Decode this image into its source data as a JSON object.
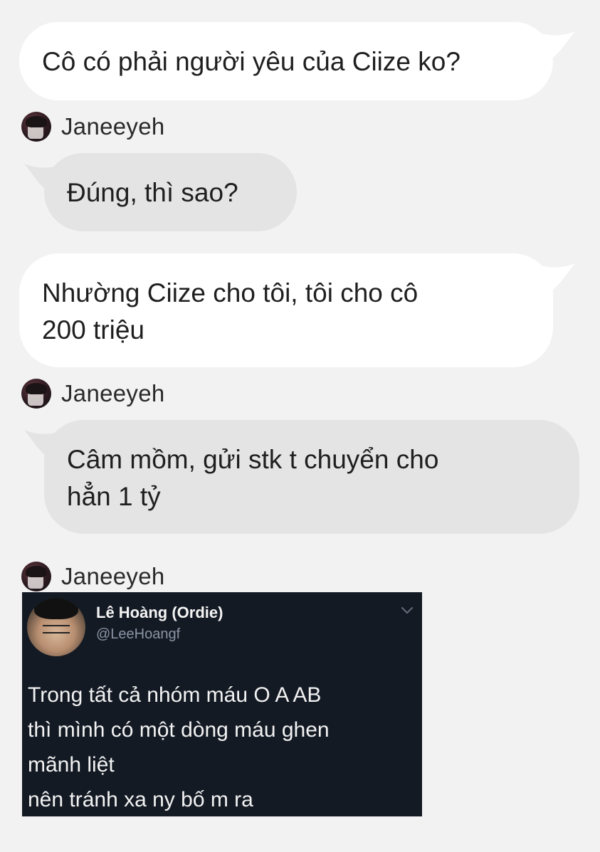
{
  "messages": [
    {
      "text_lines": [
        "Cô có phải người yêu của Ciize ko?"
      ]
    },
    {
      "sender": "Janeeyeh",
      "text_lines": [
        "Đúng, thì sao?"
      ]
    },
    {
      "text_lines": [
        "Nhường Ciize cho tôi, tôi cho cô",
        "200 triệu"
      ]
    },
    {
      "sender": "Janeeyeh",
      "text_lines": [
        "Câm mồm, gửi stk t chuyển cho",
        "hẳn 1 tỷ"
      ]
    },
    {
      "sender": "Janeeyeh"
    }
  ],
  "tweet": {
    "name": "Lê Hoàng (Ordie)",
    "handle": "@LeeHoangf",
    "body_lines": [
      "Trong tất cả nhóm máu O A AB",
      "thì mình có một dòng máu ghen",
      "mãnh liệt",
      "nên tránh xa ny bố m ra"
    ]
  },
  "colors": {
    "background": "#f2f2f2",
    "outgoing_bubble": "#ffffff",
    "incoming_bubble": "#e4e4e4",
    "tweet_background": "#141a24"
  }
}
